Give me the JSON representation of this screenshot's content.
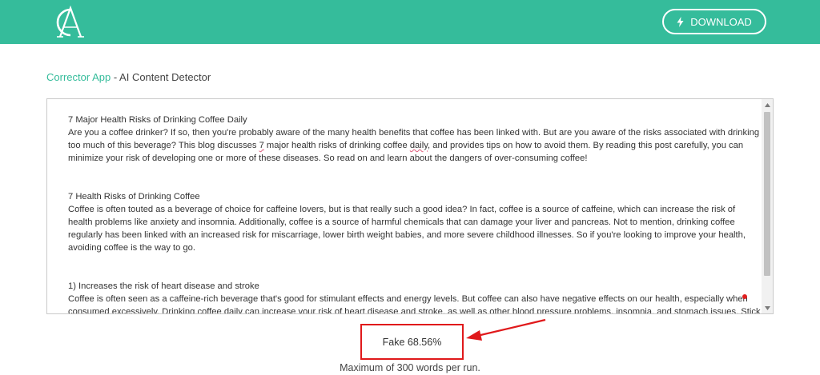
{
  "header": {
    "logo_text": "CA",
    "download_label": "DOWNLOAD",
    "download_icon": "lightning-bolt-icon",
    "background_color": "#35bc9b"
  },
  "breadcrumb": {
    "brand": "Corrector App",
    "separator": " - ",
    "page": "AI Content Detector"
  },
  "editor": {
    "paragraphs": [
      {
        "title": "7 Major Health Risks of Drinking Coffee Daily",
        "body_parts": [
          "Are you a coffee drinker? If so, then you're probably aware of the many health benefits that coffee has been linked with. But are you aware of the risks associated with drinking too much of this beverage? This blog discusses ",
          "7",
          " major health risks of drinking coffee ",
          "daily",
          ", and provides tips on how to avoid them. By reading this post carefully, you can minimize your risk of developing one or more of these diseases. So read on and learn about the dangers of over-consuming coffee!"
        ]
      },
      {
        "title": "7 Health Risks of Drinking Coffee",
        "body": "Coffee is often touted as a beverage of choice for caffeine lovers, but is that really such a good idea? In fact, coffee is a source of caffeine, which can increase the risk of health problems like anxiety and insomnia. Additionally, coffee is a source of harmful chemicals that can damage your liver and pancreas. Not to mention, drinking coffee regularly has been linked with an increased risk for miscarriage, lower birth weight babies, and more severe childhood illnesses. So if you're looking to improve your health, avoiding coffee is the way to go."
      },
      {
        "title": "1) Increases the risk of heart disease and stroke",
        "body": "Coffee is often seen as a caffeine-rich beverage that's good for stimulant effects and energy levels. But coffee can also have negative effects on our health, especially when consumed excessively. Drinking coffee daily can increase your risk of heart disease and stroke, as well as other blood pressure problems, insomnia, and stomach issues. Stick"
      }
    ]
  },
  "result": {
    "label": "Fake 68.56%",
    "border_color": "#e0191b"
  },
  "footer": {
    "note": "Maximum of 300 words per run."
  }
}
